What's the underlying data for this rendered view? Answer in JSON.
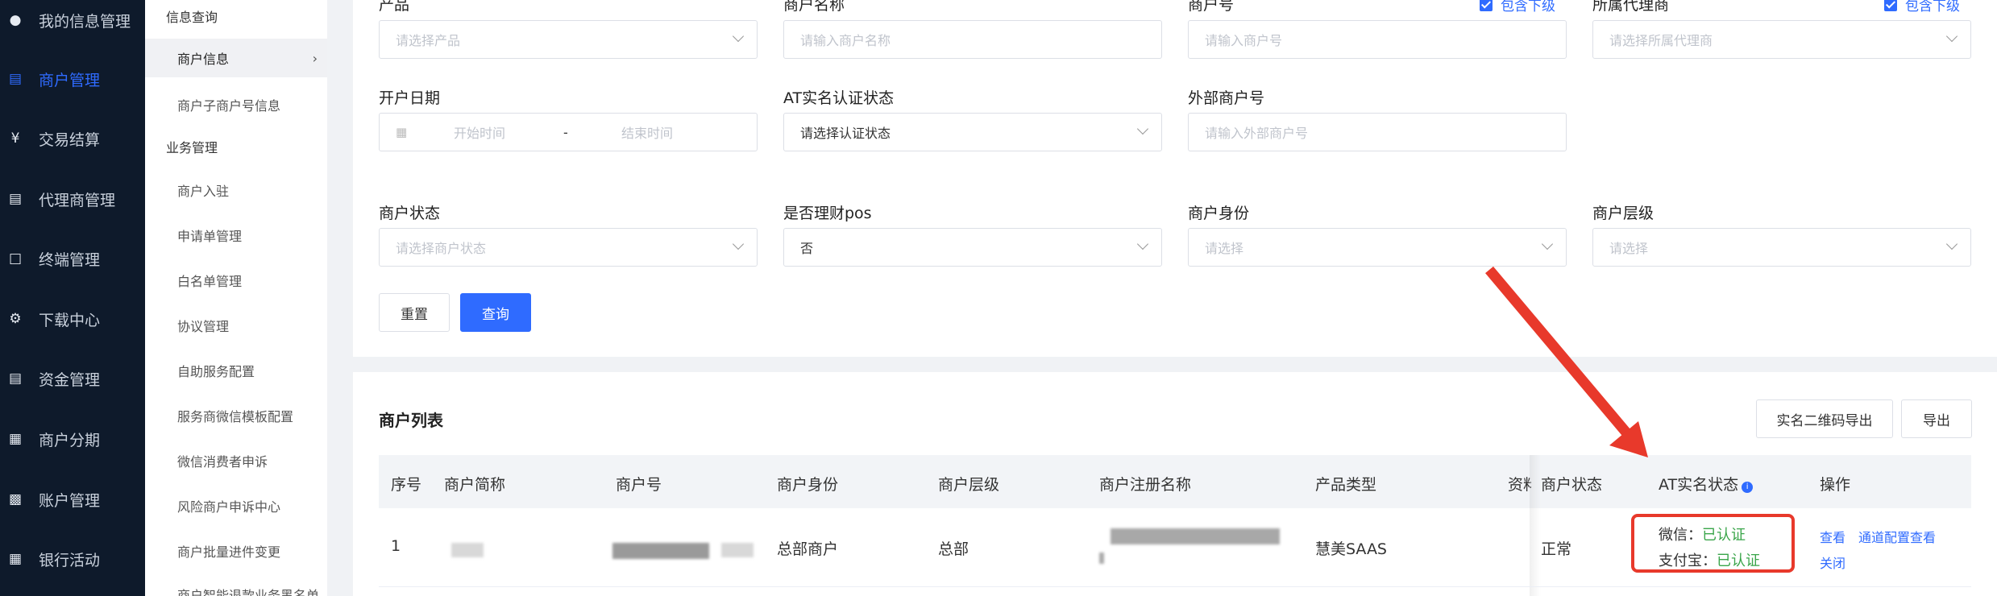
{
  "nav": {
    "items": [
      {
        "label": "我的信息管理",
        "icon": "user-icon"
      },
      {
        "label": "商户管理",
        "icon": "store-icon"
      },
      {
        "label": "交易结算",
        "icon": "yen-icon"
      },
      {
        "label": "代理商管理",
        "icon": "store-icon"
      },
      {
        "label": "终端管理",
        "icon": "terminal-icon"
      },
      {
        "label": "下载中心",
        "icon": "gear-icon"
      },
      {
        "label": "资金管理",
        "icon": "wallet-icon"
      },
      {
        "label": "商户分期",
        "icon": "calendar-icon"
      },
      {
        "label": "账户管理",
        "icon": "account-icon"
      },
      {
        "label": "银行活动",
        "icon": "gift-icon"
      }
    ],
    "active_index": 1,
    "accent_color": "#2f6bff"
  },
  "submenu": {
    "group1": "信息查询",
    "item_merchant_info": "商户信息",
    "item_sub_merchant": "商户子商户号信息",
    "group2": "业务管理",
    "items": [
      "商户入驻",
      "申请单管理",
      "白名单管理",
      "协议管理",
      "自助服务配置",
      "服务商微信模板配置",
      "微信消费者申诉",
      "风险商户申诉中心",
      "商户批量进件变更",
      "商户智能退款业务黑名单"
    ]
  },
  "filters": {
    "row1": [
      {
        "label": "产品",
        "placeholder": "请选择产品"
      },
      {
        "label": "商户名称",
        "placeholder": "请输入商户名称"
      },
      {
        "label": "商户号",
        "placeholder": "请输入商户号",
        "checkbox": "包含下级"
      },
      {
        "label": "所属代理商",
        "placeholder": "请选择所属代理商",
        "checkbox": "包含下级"
      }
    ],
    "open_date": {
      "label": "开户日期",
      "start": "开始时间",
      "sep": "-",
      "end": "结束时间"
    },
    "at_status": {
      "label": "AT实名认证状态",
      "value": "请选择认证状态"
    },
    "ext_merchant": {
      "label": "外部商户号",
      "placeholder": "请输入外部商户号"
    },
    "merchant_status": {
      "label": "商户状态",
      "placeholder": "请选择商户状态"
    },
    "finance_pos": {
      "label": "是否理财pos",
      "value": "否"
    },
    "identity": {
      "label": "商户身份",
      "placeholder": "请选择"
    },
    "level": {
      "label": "商户层级",
      "placeholder": "请选择"
    },
    "reset": "重置",
    "query": "查询"
  },
  "list": {
    "title": "商户列表",
    "export_qr": "实名二维码导出",
    "export": "导出",
    "columns": [
      "序号",
      "商户简称",
      "商户号",
      "商户身份",
      "商户层级",
      "商户注册名称",
      "产品类型",
      "资料",
      "商户状态",
      "AT实名状态",
      "操作"
    ],
    "rows": [
      {
        "index": "1",
        "identity": "总部商户",
        "level": "总部",
        "product_type": "慧美SAAS",
        "status": "正常",
        "wechat_label": "微信：",
        "wechat_status": "已认证",
        "alipay_label": "支付宝：",
        "alipay_status": "已认证",
        "actions": [
          "查看",
          "通道配置查看",
          "关闭"
        ]
      }
    ]
  }
}
